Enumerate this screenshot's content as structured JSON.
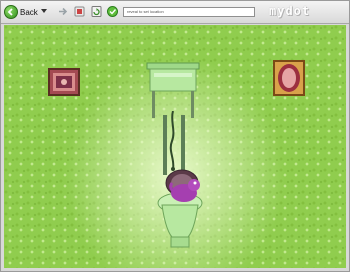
{
  "toolbar": {
    "back_label": "Back",
    "address_text": "reveal to set location",
    "brand": "mydot"
  },
  "icons": {
    "back": "back-arrow-icon",
    "dropdown": "chevron-down-icon",
    "forward": "forward-arrow-icon",
    "stop": "stop-icon",
    "refresh": "refresh-icon",
    "home": "home-icon"
  },
  "colors": {
    "wallpaper": "#90cd4e",
    "spotlight": "#eefcd2",
    "porcelain": "#b7e8a0",
    "creature": "#a53fb0"
  }
}
